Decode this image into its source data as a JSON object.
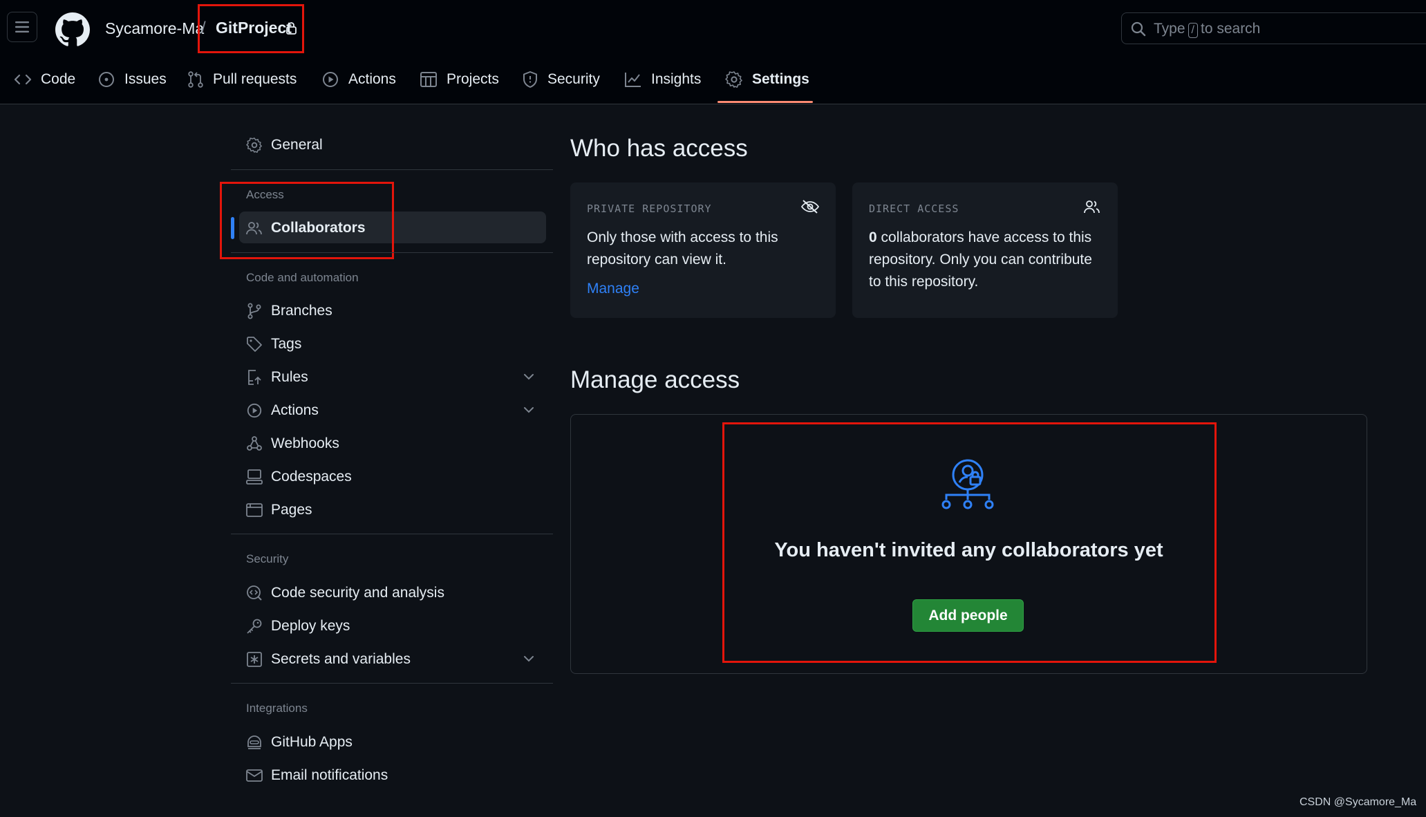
{
  "header": {
    "owner": "Sycamore-Ma",
    "separator": "/",
    "repo": "GitProject",
    "search_placeholder_pre": "Type",
    "search_key": "/",
    "search_placeholder_post": "to search"
  },
  "tabs": [
    {
      "label": "Code",
      "icon": "code-icon",
      "active": false
    },
    {
      "label": "Issues",
      "icon": "issue-icon",
      "active": false
    },
    {
      "label": "Pull requests",
      "icon": "pull-request-icon",
      "active": false
    },
    {
      "label": "Actions",
      "icon": "play-icon",
      "active": false
    },
    {
      "label": "Projects",
      "icon": "table-icon",
      "active": false
    },
    {
      "label": "Security",
      "icon": "shield-icon",
      "active": false
    },
    {
      "label": "Insights",
      "icon": "graph-icon",
      "active": false
    },
    {
      "label": "Settings",
      "icon": "gear-icon",
      "active": true
    }
  ],
  "sidebar": {
    "general": "General",
    "access_heading": "Access",
    "collaborators": "Collaborators",
    "code_heading": "Code and automation",
    "code_items": [
      "Branches",
      "Tags",
      "Rules",
      "Actions",
      "Webhooks",
      "Codespaces",
      "Pages"
    ],
    "security_heading": "Security",
    "security_items": [
      "Code security and analysis",
      "Deploy keys",
      "Secrets and variables"
    ],
    "integrations_heading": "Integrations",
    "integration_items": [
      "GitHub Apps",
      "Email notifications"
    ]
  },
  "main": {
    "who_title": "Who has access",
    "private_card": {
      "label": "PRIVATE REPOSITORY",
      "text": "Only those with access to this repository can view it.",
      "link": "Manage"
    },
    "direct_card": {
      "label": "DIRECT ACCESS",
      "count": "0",
      "text": " collaborators have access to this repository. Only you can contribute to this repository."
    },
    "manage_title": "Manage access",
    "empty_title": "You haven't invited any collaborators yet",
    "add_button": "Add people"
  },
  "colors": {
    "background": "#0d1117",
    "accent_blue": "#2f81f7",
    "button_green": "#238636",
    "tab_underline": "#fd8c73",
    "annotation_red": "#e3150b"
  },
  "watermark": "CSDN @Sycamore_Ma"
}
